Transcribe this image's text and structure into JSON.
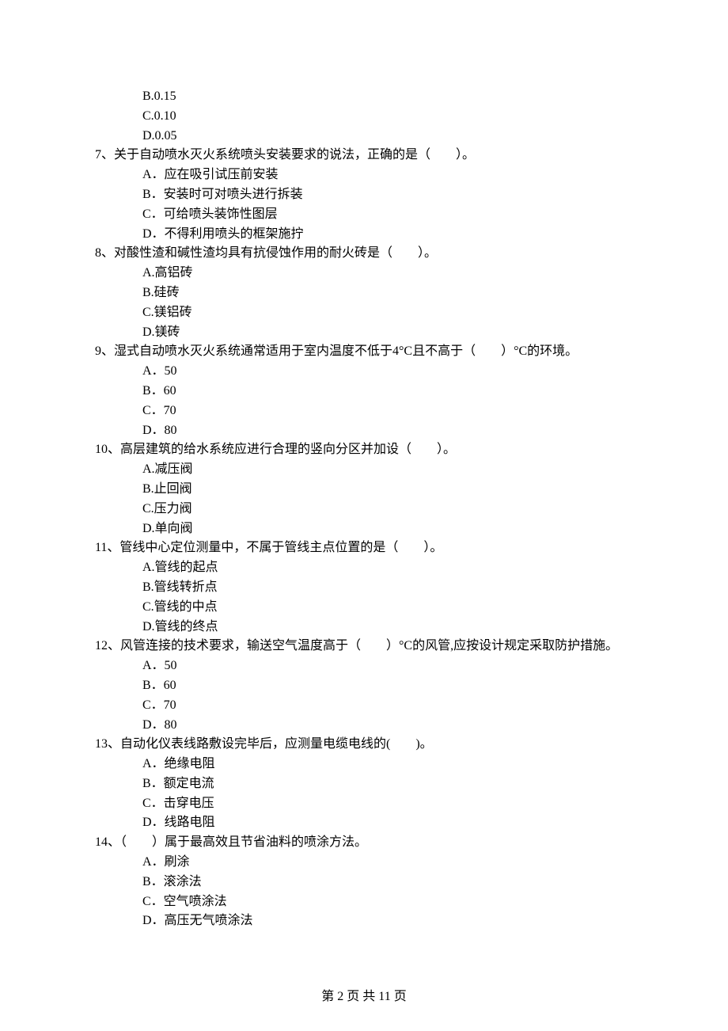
{
  "prev_options": {
    "b": "B.0.15",
    "c": "C.0.10",
    "d": "D.0.05"
  },
  "q7": {
    "stem": "7、关于自动喷水灭火系统喷头安装要求的说法，正确的是（　　）。",
    "a": "A．应在吸引试压前安装",
    "b": "B．安装时可对喷头进行拆装",
    "c": "C．可给喷头装饰性图层",
    "d": "D．不得利用喷头的框架施拧"
  },
  "q8": {
    "stem": "8、对酸性渣和碱性渣均具有抗侵蚀作用的耐火砖是（　　）。",
    "a": "A.高铝砖",
    "b": "B.硅砖",
    "c": "C.镁铝砖",
    "d": "D.镁砖"
  },
  "q9": {
    "stem": "9、湿式自动喷水灭火系统通常适用于室内温度不低于4°C且不高于（　　）°C的环境。",
    "a": "A．50",
    "b": "B．60",
    "c": "C．70",
    "d": "D．80"
  },
  "q10": {
    "stem": "10、高层建筑的给水系统应进行合理的竖向分区并加设（　　）。",
    "a": "A.减压阀",
    "b": "B.止回阀",
    "c": "C.压力阀",
    "d": "D.单向阀"
  },
  "q11": {
    "stem": "11、管线中心定位测量中，不属于管线主点位置的是（　　）。",
    "a": "A.管线的起点",
    "b": "B.管线转折点",
    "c": "C.管线的中点",
    "d": "D.管线的终点"
  },
  "q12": {
    "stem": "12、风管连接的技术要求，输送空气温度高于（　　）°C的风管,应按设计规定采取防护措施。",
    "a": "A．50",
    "b": "B．60",
    "c": "C．70",
    "d": "D．80"
  },
  "q13": {
    "stem": "13、自动化仪表线路敷设完毕后，应测量电缆电线的(　　)。",
    "a": "A．绝缘电阻",
    "b": "B．额定电流",
    "c": "C．击穿电压",
    "d": "D．线路电阻"
  },
  "q14": {
    "stem": "14、（　　）属于最高效且节省油料的喷涂方法。",
    "a": "A．刷涂",
    "b": "B．滚涂法",
    "c": "C．空气喷涂法",
    "d": "D．高压无气喷涂法"
  },
  "footer": "第 2 页 共 11 页"
}
